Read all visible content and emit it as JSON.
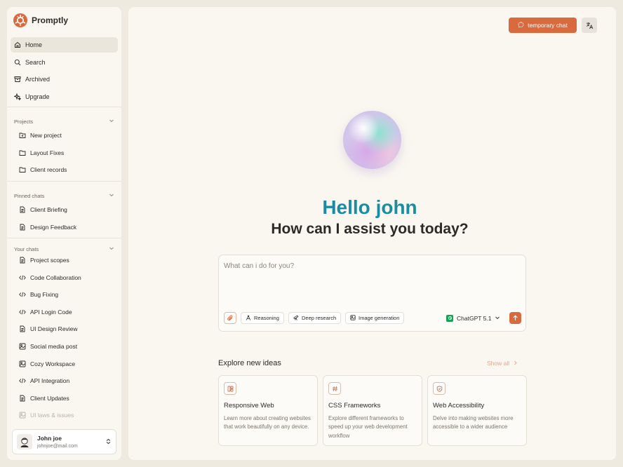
{
  "brand": {
    "name": "Promptly",
    "color": "#d96a3e"
  },
  "nav": [
    {
      "label": "Home",
      "icon": "home-icon",
      "active": true
    },
    {
      "label": "Search",
      "icon": "search-icon"
    },
    {
      "label": "Archived",
      "icon": "archive-icon"
    },
    {
      "label": "Upgrade",
      "icon": "sparkle-icon"
    }
  ],
  "projects": {
    "title": "Projects",
    "items": [
      {
        "label": "New project",
        "icon": "folder-plus-icon"
      },
      {
        "label": "Layout Fixes",
        "icon": "folder-icon"
      },
      {
        "label": "Client records",
        "icon": "folder-icon"
      }
    ]
  },
  "pinned": {
    "title": "Pinned chats",
    "items": [
      {
        "label": "Client Briefing",
        "icon": "document-icon"
      },
      {
        "label": "Design Feedback",
        "icon": "document-icon"
      }
    ]
  },
  "chats": {
    "title": "Your chats",
    "items": [
      {
        "label": "Project scopes",
        "icon": "document-icon"
      },
      {
        "label": "Code Collaboration",
        "icon": "code-icon"
      },
      {
        "label": "Bug Fixing",
        "icon": "code-icon"
      },
      {
        "label": "API Login Code",
        "icon": "code-icon"
      },
      {
        "label": "UI Design Review",
        "icon": "document-icon"
      },
      {
        "label": "Social media post",
        "icon": "image-icon"
      },
      {
        "label": "Cozy Workspace",
        "icon": "image-icon"
      },
      {
        "label": "API Integration",
        "icon": "code-icon"
      },
      {
        "label": "Client Updates",
        "icon": "document-icon"
      },
      {
        "label": "UI laws & issues",
        "icon": "image-icon"
      }
    ]
  },
  "user": {
    "name": "John joe",
    "email": "johnjoe@mail.com"
  },
  "header": {
    "temp_chat_label": "temporary chat"
  },
  "hero": {
    "greeting": "Hello john",
    "subtitle": "How can I assist you today?"
  },
  "composer": {
    "placeholder": "What can i do for you?",
    "tools": [
      {
        "label": "Reasoning",
        "icon": "compass-icon"
      },
      {
        "label": "Deep research",
        "icon": "telescope-icon"
      },
      {
        "label": "Image generation",
        "icon": "image-icon"
      }
    ],
    "model": "ChatGPT 5.1"
  },
  "explore": {
    "title": "Explore new ideas",
    "show_all": "Show all",
    "cards": [
      {
        "title": "Responsive Web",
        "icon": "layout-icon",
        "desc": "Learn more about creating websites that work beautifully on any device."
      },
      {
        "title": "CSS Frameworks",
        "icon": "hash-icon",
        "desc": "Explore different frameworks to speed up your web development workflow"
      },
      {
        "title": "Web Accessibility",
        "icon": "shield-icon",
        "desc": "Delve into making websites more accessible to a wider audience"
      }
    ]
  }
}
